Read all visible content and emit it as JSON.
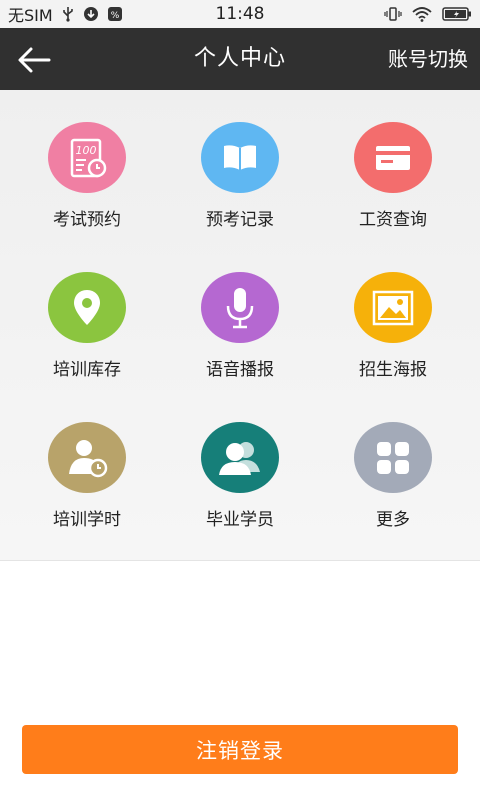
{
  "status_bar": {
    "carrier": "无SIM",
    "time": "11:48"
  },
  "header": {
    "title": "个人中心",
    "right_action": "账号切换"
  },
  "grid": [
    {
      "label": "考试预约",
      "icon": "exam-score-icon",
      "color": "#f07fa3"
    },
    {
      "label": "预考记录",
      "icon": "open-book-icon",
      "color": "#5fb7f2"
    },
    {
      "label": "工资查询",
      "icon": "card-icon",
      "color": "#f36d6d"
    },
    {
      "label": "培训库存",
      "icon": "location-pin-icon",
      "color": "#8bc53f"
    },
    {
      "label": "语音播报",
      "icon": "microphone-icon",
      "color": "#b568d1"
    },
    {
      "label": "招生海报",
      "icon": "poster-image-icon",
      "color": "#f6b10a"
    },
    {
      "label": "培训学时",
      "icon": "person-clock-icon",
      "color": "#b8a36a"
    },
    {
      "label": "毕业学员",
      "icon": "users-icon",
      "color": "#167f79"
    },
    {
      "label": "更多",
      "icon": "more-grid-icon",
      "color": "#a3aab8"
    }
  ],
  "logout_label": "注销登录"
}
